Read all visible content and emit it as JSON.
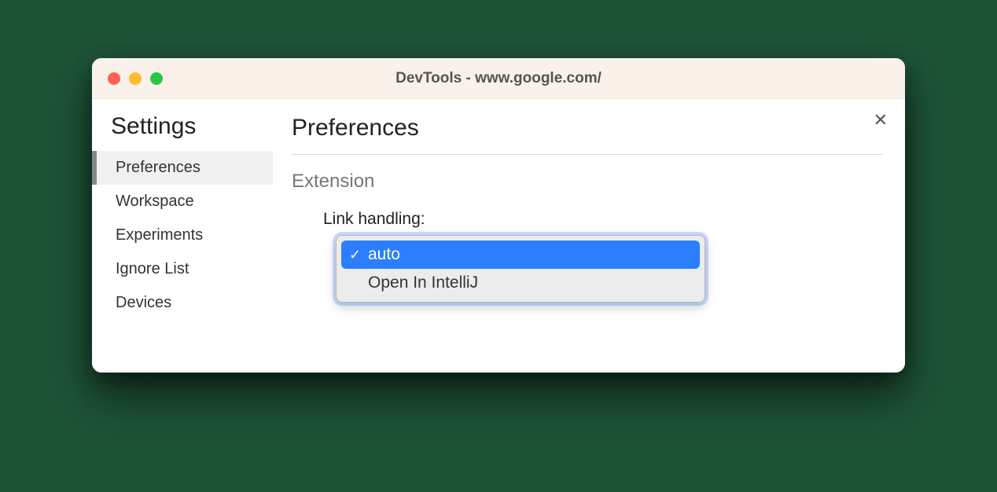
{
  "window": {
    "title": "DevTools - www.google.com/"
  },
  "sidebar": {
    "heading": "Settings",
    "items": [
      {
        "label": "Preferences",
        "active": true
      },
      {
        "label": "Workspace",
        "active": false
      },
      {
        "label": "Experiments",
        "active": false
      },
      {
        "label": "Ignore List",
        "active": false
      },
      {
        "label": "Devices",
        "active": false
      }
    ]
  },
  "main": {
    "heading": "Preferences",
    "section_heading": "Extension",
    "field_label": "Link handling:",
    "dropdown": {
      "options": [
        {
          "label": "auto",
          "selected": true
        },
        {
          "label": "Open In IntelliJ",
          "selected": false
        }
      ]
    }
  },
  "icons": {
    "check": "✓",
    "close": "✕"
  }
}
